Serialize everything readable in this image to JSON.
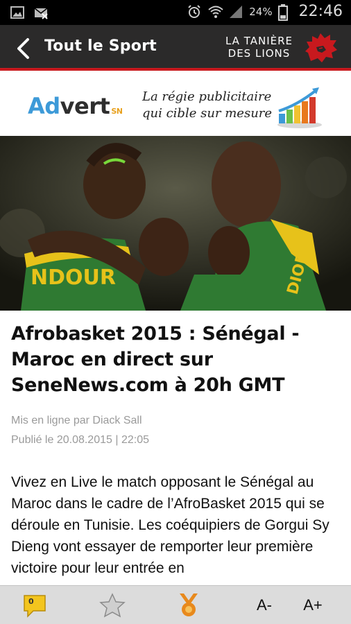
{
  "status_bar": {
    "battery_percent": "24%",
    "time": "22:46",
    "icons": [
      "gallery-icon",
      "mail-muted-icon",
      "alarm-icon",
      "wifi-icon",
      "signal-icon",
      "battery-icon"
    ]
  },
  "app_bar": {
    "back_icon": "chevron-left-icon",
    "section_title": "Tout le Sport",
    "brand_line1": "LA TANIÈRE",
    "brand_line2": "DES LIONS",
    "brand_logo": "lion-head-icon",
    "accent_color": "#c8191e"
  },
  "ad_banner": {
    "brand_part1": "Ad",
    "brand_part2": "vert",
    "brand_suffix": "SN",
    "tagline_line1": "La régie publicitaire",
    "tagline_line2": "qui cible sur mesure",
    "chart_icon": "growth-chart-icon"
  },
  "article": {
    "headline": "Afrobasket 2015 : Sénégal - Maroc en direct sur SeneNews.com à 20h GMT",
    "author": "Mis en ligne par Diack Sall",
    "published": "Publié le 20.08.2015 | 22:05",
    "body": "Vivez en Live le match opposant le Sénégal au Maroc dans le cadre de l’AfroBasket 2015 qui se déroule en Tunisie. Les coéquipiers de Gorgui Sy Dieng vont essayer de remporter leur première victoire pour leur entrée en",
    "jersey_text": "NDOUR"
  },
  "toolbar": {
    "comment_count": "0",
    "comment_icon": "comment-icon",
    "favorite_icon": "star-icon",
    "medal_icon": "medal-icon",
    "font_decrease": "A-",
    "font_increase": "A+"
  }
}
